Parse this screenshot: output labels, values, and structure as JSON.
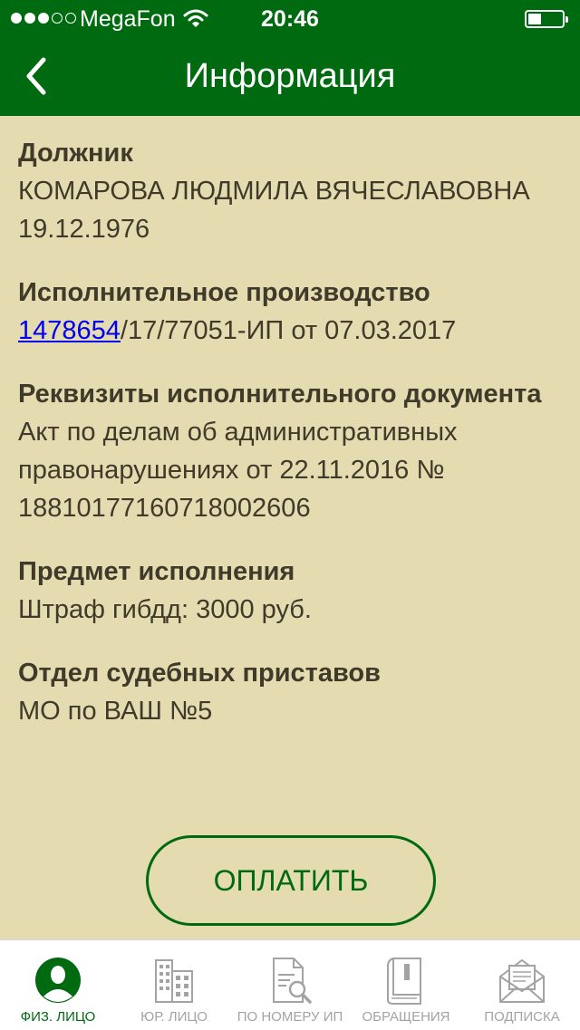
{
  "status_bar": {
    "signal_dots_filled": 3,
    "signal_dots_total": 5,
    "carrier": "MegaFon",
    "time": "20:46",
    "battery_level": 0.4
  },
  "header": {
    "title": "Информация",
    "back_icon": "chevron-left-icon"
  },
  "sections": [
    {
      "label": "Должник",
      "value": "КОМАРОВА ЛЮДМИЛА ВЯЧЕСЛАВОВНА 19.12.1976"
    },
    {
      "label": "Исполнительное производство",
      "value_link": "1478654",
      "value_rest": "/17/77051-ИП от 07.03.2017"
    },
    {
      "label": "Реквизиты исполнительного документа",
      "value": "Акт по делам об административных правонарушениях от 22.11.2016 № 18810177160718002606"
    },
    {
      "label": "Предмет исполнения",
      "value": "Штраф гибдд: 3000 руб."
    },
    {
      "label": "Отдел судебных приставов",
      "value": "МО по ВАШ №5"
    }
  ],
  "pay_button": {
    "label": "ОПЛАТИТЬ"
  },
  "tab_bar": {
    "active": 0,
    "colors": {
      "active": "#006a10",
      "inactive": "#a3a3a3"
    },
    "tabs": [
      {
        "label": "ФИЗ. ЛИЦО",
        "icon": "person-icon"
      },
      {
        "label": "ЮР. ЛИЦО",
        "icon": "building-icon"
      },
      {
        "label": "ПО НОМЕРУ ИП",
        "icon": "document-search-icon"
      },
      {
        "label": "ОБРАЩЕНИЯ",
        "icon": "binder-icon"
      },
      {
        "label": "ПОДПИСКА",
        "icon": "envelope-icon"
      }
    ]
  },
  "colors": {
    "header_bg": "#006a10",
    "page_bg": "#e4dbb0",
    "text": "#3f3a29",
    "link": "#0000ee"
  }
}
